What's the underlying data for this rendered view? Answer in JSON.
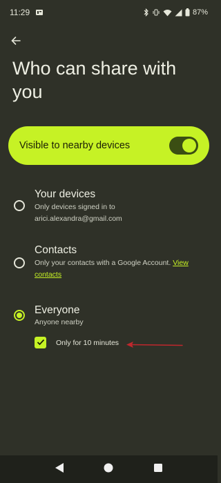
{
  "status_bar": {
    "time": "11:29",
    "battery": "87%",
    "icons": [
      "notification-icon",
      "bluetooth-icon",
      "vibrate-icon",
      "wifi-icon",
      "signal-icon",
      "battery-icon"
    ]
  },
  "header": {
    "back_icon": "arrow-back-icon",
    "title": "Who can share with you"
  },
  "visibility": {
    "label": "Visible to nearby devices",
    "enabled": true
  },
  "options": [
    {
      "title": "Your devices",
      "description": "Only devices signed in to arici.alexandra@gmail.com",
      "selected": false
    },
    {
      "title": "Contacts",
      "description": "Only your contacts with a Google Account.",
      "link": "View contacts",
      "selected": false
    },
    {
      "title": "Everyone",
      "description": "Anyone nearby",
      "selected": true
    }
  ],
  "everyone_option": {
    "checkbox_label": "Only for 10 minutes",
    "checked": true
  },
  "annotation": {
    "arrow_color": "#c1272d"
  },
  "colors": {
    "accent": "#c6f225",
    "background": "#2f3128"
  }
}
